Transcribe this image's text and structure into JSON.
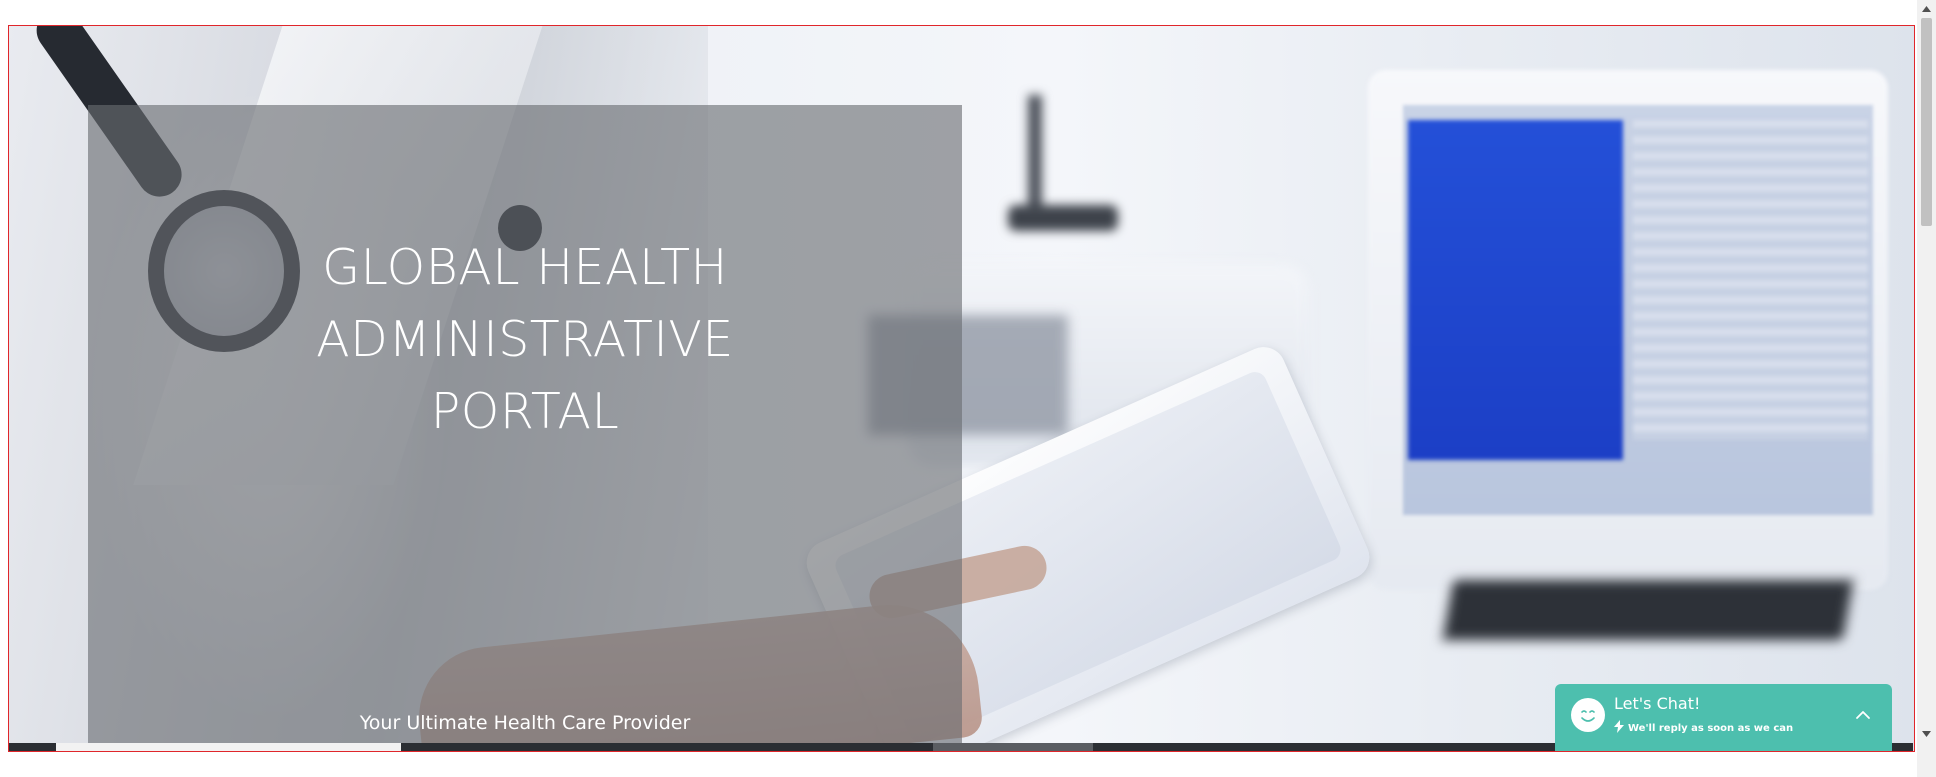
{
  "hero": {
    "title_lines": [
      "GLOBAL HEALTH",
      "ADMINISTRATIVE",
      "PORTAL"
    ],
    "subtitle": "Your Ultimate Health Care Provider",
    "overlay_color": "#696c71"
  },
  "chat": {
    "title": "Let's Chat!",
    "subtitle": "We'll reply as soon as we can",
    "accent_color": "#4dbfae",
    "avatar_icon": "smiley-face-icon",
    "bolt_icon": "lightning-bolt-icon",
    "toggle_icon": "chevron-up-icon"
  },
  "scrollbar": {
    "up_icon": "scroll-up-arrow-icon",
    "down_icon": "scroll-down-arrow-icon"
  },
  "colors": {
    "outline": "#e0262b",
    "strip_dark": "#2b2e33"
  }
}
